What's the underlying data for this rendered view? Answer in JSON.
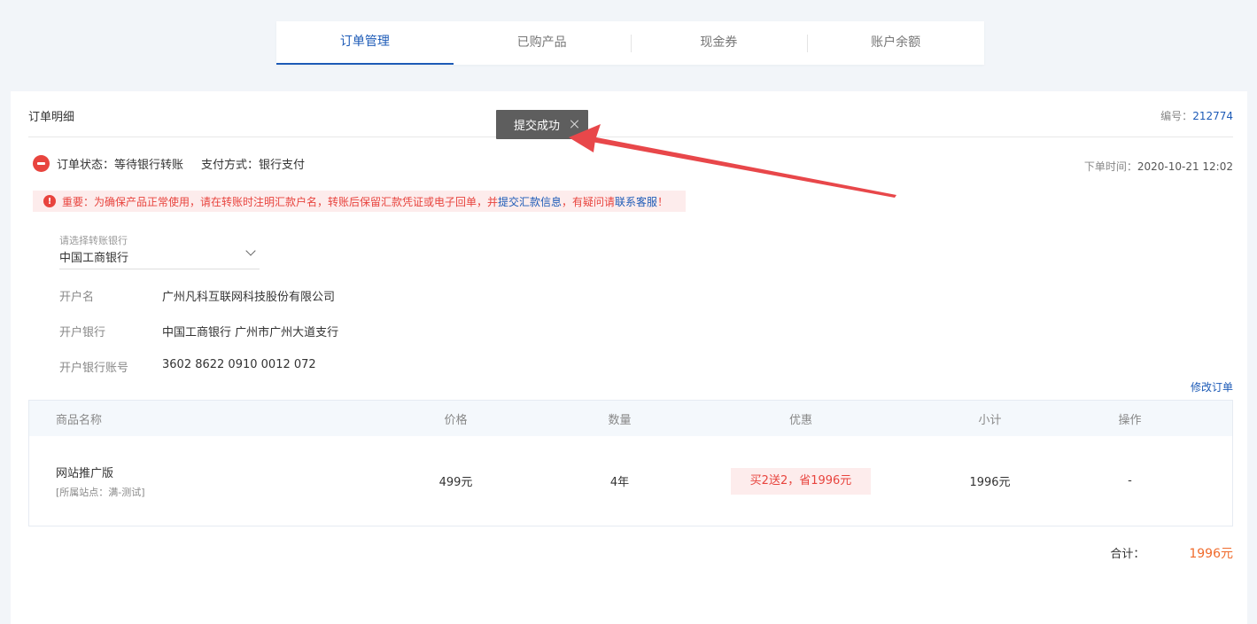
{
  "tabs": [
    {
      "label": "订单管理",
      "active": true
    },
    {
      "label": "已购产品",
      "active": false
    },
    {
      "label": "现金券",
      "active": false
    },
    {
      "label": "账户余额",
      "active": false
    }
  ],
  "panel": {
    "title": "订单明细",
    "order_no_label": "编号：",
    "order_no": "212774"
  },
  "status": {
    "state": "订单状态：等待银行转账",
    "pay": "支付方式：银行支付",
    "time_label": "下单时间：",
    "time": "2020-10-21 12:02"
  },
  "warning": {
    "text1": "重要：为确保产品正常使用，请在转账时注明汇款户名，转账后保留汇款凭证或电子回单，并",
    "link1": "提交汇款信息",
    "text2": "，有疑问请",
    "link2": "联系客服",
    "text3": "！"
  },
  "bank_select": {
    "label": "请选择转账银行",
    "value": "中国工商银行"
  },
  "account": {
    "name_label": "开户名",
    "name": "广州凡科互联网科技股份有限公司",
    "bank_label": "开户银行",
    "bank": "中国工商银行 广州市广州大道支行",
    "number_label": "开户银行账号",
    "number": "3602 8622 0910 0012 072"
  },
  "modify_label": "修改订单",
  "table": {
    "headers": [
      "商品名称",
      "价格",
      "数量",
      "优惠",
      "小计",
      "操作"
    ],
    "row": {
      "name": "网站推广版",
      "site": "[所属站点：满-测试]",
      "price": "499元",
      "qty": "4年",
      "promo": "买2送2，省1996元",
      "subtotal": "1996元",
      "op": "-"
    }
  },
  "total": {
    "label": "合计：",
    "value": "1996元"
  },
  "toast": {
    "text": "提交成功"
  },
  "colors": {
    "accent": "#1d5bb7",
    "danger": "#e8443e",
    "total": "#f06b2c"
  }
}
